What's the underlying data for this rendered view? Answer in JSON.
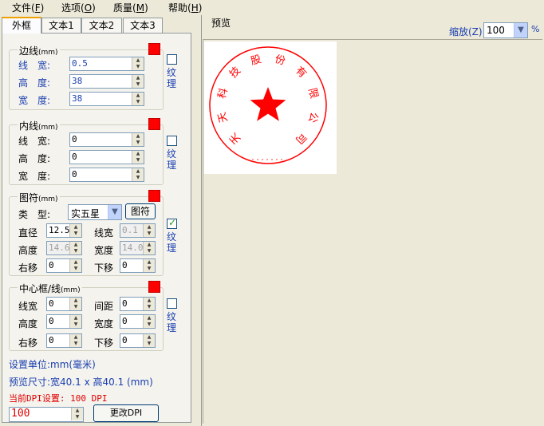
{
  "menu": [
    {
      "label": "文件",
      "key": "F"
    },
    {
      "label": "选项",
      "key": "O"
    },
    {
      "label": "质量",
      "key": "M"
    },
    {
      "label": "帮助",
      "key": "H"
    }
  ],
  "tabs": [
    "外框",
    "文本1",
    "文本2",
    "文本3"
  ],
  "preview": {
    "title": "预览",
    "zoom_label": "缩放(Z)",
    "zoom_value": "100",
    "zoom_unit": "%"
  },
  "border_group": {
    "title": "边线",
    "unit": "(mm)",
    "color": "#ff0000",
    "fields": [
      {
        "label": "线　宽:",
        "value": "0.5"
      },
      {
        "label": "高　度:",
        "value": "38"
      },
      {
        "label": "宽　度:",
        "value": "38"
      }
    ],
    "texture_label": "纹理",
    "texture_checked": false
  },
  "inner_group": {
    "title": "内线",
    "unit": "(mm)",
    "color": "#ff0000",
    "fields": [
      {
        "label": "线　宽:",
        "value": "0"
      },
      {
        "label": "高　度:",
        "value": "0"
      },
      {
        "label": "宽　度:",
        "value": "0"
      }
    ],
    "texture_label": "纹理",
    "texture_checked": false
  },
  "symbol_group": {
    "title": "图符",
    "unit": "(mm)",
    "color": "#ff0000",
    "type_label": "类　型:",
    "type_value": "实五星",
    "symbol_button": "图符",
    "diameter_label": "直径",
    "diameter_value": "12.5",
    "linewidth_label": "线宽",
    "linewidth_value": "0.1",
    "height_label": "高度",
    "height_value": "14.6",
    "width_label": "宽度",
    "width_value": "14.0",
    "right_label": "右移",
    "right_value": "0",
    "down_label": "下移",
    "down_value": "0",
    "texture_label": "纹理",
    "texture_checked": true
  },
  "center_group": {
    "title": "中心框/线",
    "unit": "(mm)",
    "color": "#ff0000",
    "linewidth_label": "线宽",
    "linewidth_value": "0",
    "spacing_label": "间距",
    "spacing_value": "0",
    "height_label": "高度",
    "height_value": "0",
    "width_label": "宽度",
    "width_value": "0",
    "right_label": "右移",
    "right_value": "0",
    "down_label": "下移",
    "down_value": "0",
    "texture_label": "纹理",
    "texture_checked": false
  },
  "footer": {
    "unit_text": "设置单位:mm(毫米)",
    "size_text": "预览尺寸:宽40.1 x 高40.1 (mm)",
    "dpi_text": "当前DPI设置: 100 DPI",
    "dpi_value": "100",
    "change_dpi_button": "更改DPI"
  },
  "seal": {
    "text": "天天科技股份有限公司",
    "color": "#ff0000"
  }
}
